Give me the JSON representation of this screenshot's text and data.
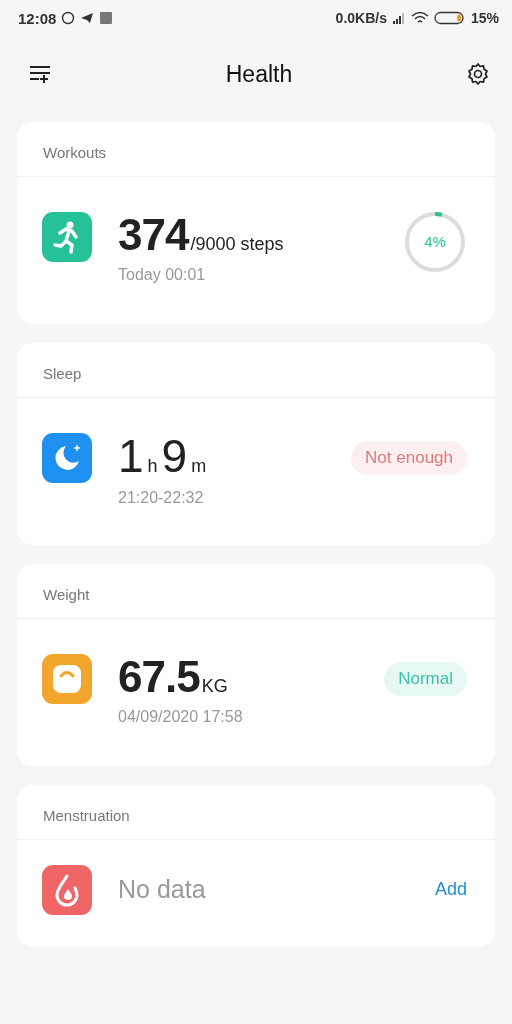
{
  "status_bar": {
    "time": "12:08",
    "speed": "0.0KB/s",
    "battery": "15%"
  },
  "header": {
    "title": "Health"
  },
  "cards": [
    {
      "kind": "steps",
      "title": "Workouts",
      "color": "#26c196",
      "bold_value": true,
      "value_parts": [
        {
          "kind": "num",
          "text": "374"
        },
        {
          "kind": "unit",
          "text": "/9000 steps"
        }
      ],
      "sub": "Today 00:01",
      "progress": {
        "label": "4%"
      }
    },
    {
      "kind": "sleep",
      "title": "Sleep",
      "color": "#1e90f0",
      "bold_value": false,
      "value_parts": [
        {
          "kind": "num",
          "text": "1"
        },
        {
          "kind": "unit",
          "text": "h"
        },
        {
          "kind": "num",
          "text": "9"
        },
        {
          "kind": "unit",
          "text": "m"
        }
      ],
      "sub": "21:20-22:32",
      "badge": {
        "label": "Not enough",
        "color": "#e07a7a"
      }
    },
    {
      "kind": "weight",
      "title": "Weight",
      "color": "#f2a72c",
      "bold_value": true,
      "value_parts": [
        {
          "kind": "num",
          "text": "67.5"
        },
        {
          "kind": "unit",
          "text": "KG"
        }
      ],
      "sub": "04/09/2020 17:58",
      "badge": {
        "label": "Normal",
        "color": "#3cc2a8"
      }
    },
    {
      "kind": "period",
      "title": "Menstruation",
      "color": "#f06565",
      "empty_text": "No data",
      "action": "Add"
    }
  ]
}
